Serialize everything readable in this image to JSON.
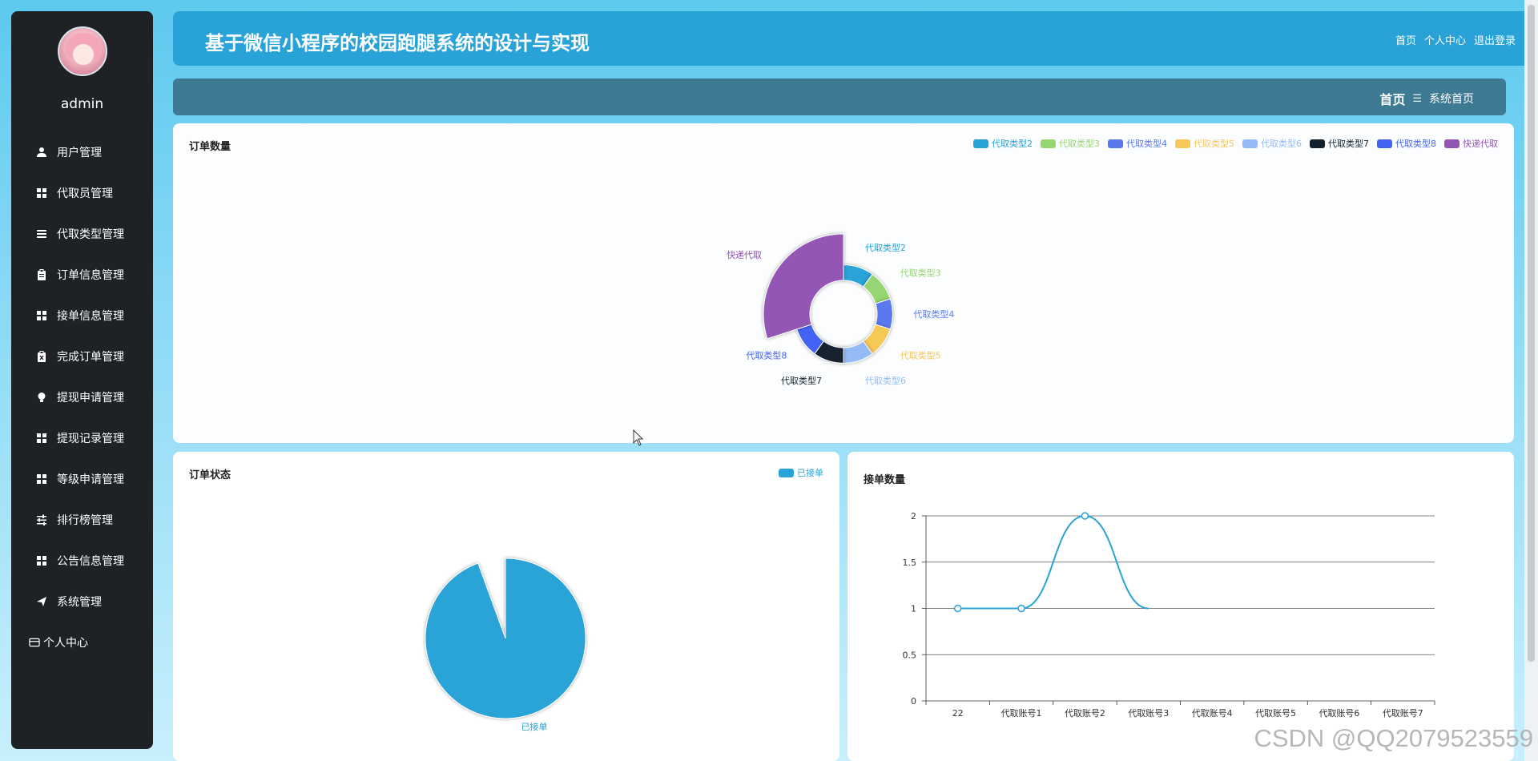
{
  "colors": {
    "sidebar_bg": "#1e2126",
    "header_bg": "#29a3d7",
    "breadcrumb_bg": "#3e7a93",
    "series": [
      "#29a3d7",
      "#96d672",
      "#5b78ef",
      "#f6c857",
      "#94bbf5",
      "#12232f",
      "#4364f3",
      "#9356b5"
    ]
  },
  "sidebar": {
    "username": "admin",
    "items": [
      {
        "label": "用户管理",
        "icon": "user-icon"
      },
      {
        "label": "代取员管理",
        "icon": "grid-icon"
      },
      {
        "label": "代取类型管理",
        "icon": "list-icon"
      },
      {
        "label": "订单信息管理",
        "icon": "clipboard-icon"
      },
      {
        "label": "接单信息管理",
        "icon": "grid-icon"
      },
      {
        "label": "完成订单管理",
        "icon": "clipboard-x-icon"
      },
      {
        "label": "提现申请管理",
        "icon": "bulb-icon"
      },
      {
        "label": "提现记录管理",
        "icon": "grid-icon"
      },
      {
        "label": "等级申请管理",
        "icon": "grid-icon"
      },
      {
        "label": "排行榜管理",
        "icon": "sliders-icon"
      },
      {
        "label": "公告信息管理",
        "icon": "grid-icon"
      },
      {
        "label": "系统管理",
        "icon": "send-icon"
      },
      {
        "label": "个人中心",
        "icon": "card-icon"
      }
    ]
  },
  "header": {
    "title": "基于微信小程序的校园跑腿系统的设计与实现",
    "links": [
      "首页",
      "个人中心",
      "退出登录"
    ]
  },
  "breadcrumb": {
    "home": "首页",
    "separator": "☰",
    "current": "系统首页"
  },
  "watermark": "CSDN @QQ2079523559",
  "charts": {
    "order_count": {
      "title": "订单数量"
    },
    "order_status": {
      "title": "订单状态"
    },
    "taken_count": {
      "title": "接单数量"
    }
  },
  "chart_data": [
    {
      "type": "pie",
      "title": "订单数量",
      "donut": true,
      "legend_position": "top-right",
      "categories": [
        "代取类型2",
        "代取类型3",
        "代取类型4",
        "代取类型5",
        "代取类型6",
        "代取类型7",
        "代取类型8",
        "快递代取"
      ],
      "values": [
        1,
        1,
        1,
        1,
        1,
        1,
        1,
        3
      ]
    },
    {
      "type": "pie",
      "title": "订单状态",
      "legend_position": "top-right",
      "categories": [
        "已接单"
      ],
      "values": [
        1
      ]
    },
    {
      "type": "line",
      "title": "接单数量",
      "smooth": true,
      "grid": true,
      "categories": [
        "22",
        "代取账号1",
        "代取账号2",
        "代取账号3",
        "代取账号4",
        "代取账号5",
        "代取账号6",
        "代取账号7"
      ],
      "series": [
        {
          "values": [
            1,
            1,
            2,
            1
          ]
        }
      ],
      "yticks": [
        "0",
        "0.5",
        "1",
        "1.5",
        "2"
      ],
      "ylim": [
        0,
        2
      ]
    }
  ]
}
